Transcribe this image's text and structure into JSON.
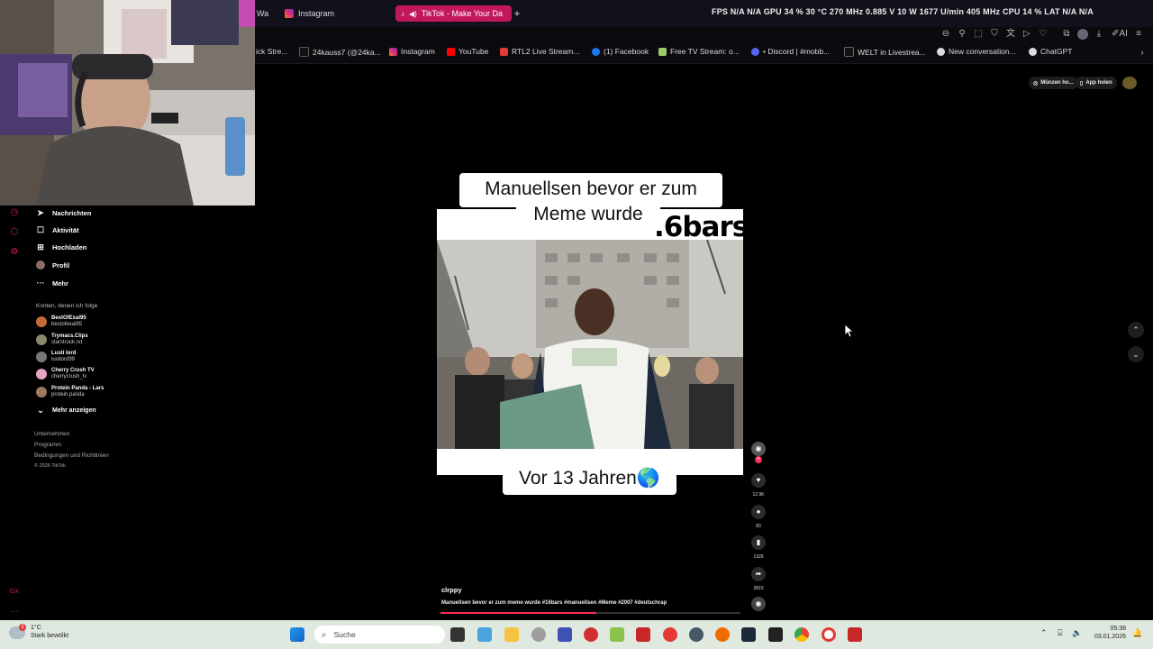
{
  "tabs": [
    {
      "label": "Wa",
      "active": false,
      "icon": "partial-tab-icon"
    },
    {
      "label": "Instagram",
      "active": false,
      "icon": "instagram-icon"
    },
    {
      "label": "TikTok - Make Your Da",
      "active": true,
      "icon": "tiktok-icon"
    }
  ],
  "perf_overlay": "FPS N/A N/A   GPU 34 % 30 °C 270 MHz 0.885 V 10 W 1677 U/min 405 MHz   CPU 14 %   LAT N/A N/A",
  "bookmarks": [
    {
      "label": "ick Stre...",
      "icon": "bookmark-icon"
    },
    {
      "label": "24kauss7 (@24ka...",
      "icon": "tiktok-icon"
    },
    {
      "label": "Instagram",
      "icon": "instagram-icon"
    },
    {
      "label": "YouTube",
      "icon": "youtube-icon"
    },
    {
      "label": "RTL2 Live Stream...",
      "icon": "rtl2-icon"
    },
    {
      "label": "(1) Facebook",
      "icon": "facebook-icon"
    },
    {
      "label": "Free TV Stream: o...",
      "icon": "tv-icon"
    },
    {
      "label": "• Discord | #mobb...",
      "icon": "discord-icon"
    },
    {
      "label": "WELT in Livestrea...",
      "icon": "welt-icon"
    },
    {
      "label": "New conversation...",
      "icon": "openai-icon"
    },
    {
      "label": "ChatGPT",
      "icon": "openai-icon"
    }
  ],
  "tiktok": {
    "nav": [
      {
        "label": "Nachrichten",
        "icon": "send-icon"
      },
      {
        "label": "Aktivität",
        "icon": "inbox-icon"
      },
      {
        "label": "Hochladen",
        "icon": "upload-icon"
      },
      {
        "label": "Profil",
        "icon": "avatar-icon"
      },
      {
        "label": "Mehr",
        "icon": "more-icon"
      }
    ],
    "following_title": "Konten, denen ich folge",
    "accounts": [
      {
        "name": "BestOfExal95",
        "handle": "bestofexal95",
        "color": "#c56a3a"
      },
      {
        "name": "Trymacs.Clips",
        "handle": "starstruck.rxt",
        "color": "#8a8a6a"
      },
      {
        "name": "Lusti lord",
        "handle": "lustlord99",
        "color": "#777"
      },
      {
        "name": "Cherry Crush TV",
        "handle": "cherrycrush_tv",
        "color": "#e7a2c6"
      },
      {
        "name": "Protein Panda - Lars",
        "handle": "protein.panda",
        "color": "#a0785a"
      }
    ],
    "show_more": "Mehr anzeigen",
    "footer": [
      "Unternehmen",
      "Programm",
      "Bedingungen und Richtlinien",
      "© 2026 TikTok"
    ],
    "top_buttons": {
      "coins": "Münzen ho...",
      "app": "App holen"
    },
    "video": {
      "caption_top_1": "Manuellsen bevor er zum",
      "caption_top_2": "Meme wurde",
      "watermark": ".6bars",
      "caption_bottom": "Vor 13 Jahren🌎",
      "author": "clrppy",
      "description": "Manuellsen bevor er zum meme wurde #16bars #manuellsen #Meme #2007 #deutschrap",
      "progress": 0.52
    },
    "actions": [
      {
        "name": "like",
        "count": "12.9K",
        "icon": "heart-icon"
      },
      {
        "name": "comment",
        "count": "83",
        "icon": "comment-icon"
      },
      {
        "name": "save",
        "count": "1326",
        "icon": "bookmark-icon"
      },
      {
        "name": "share",
        "count": "3810",
        "icon": "share-icon"
      }
    ]
  },
  "taskbar": {
    "weather_temp": "1°C",
    "weather_desc": "Stark bewölkt",
    "search_placeholder": "Suche",
    "time": "05:38",
    "date": "03.01.2026"
  },
  "colors": {
    "accent": "#fe2c55",
    "tab_active": "#c2185b",
    "taskbar": "#dfe9df"
  }
}
